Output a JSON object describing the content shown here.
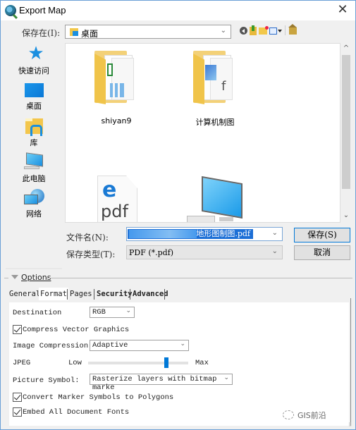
{
  "window": {
    "title": "Export Map",
    "close_glyph": "✕"
  },
  "lookin": {
    "label": "保存在(I):",
    "value": "桌面",
    "chevron": "⌄",
    "toolbar": [
      "back-icon",
      "up-folder-icon",
      "new-folder-icon",
      "view-menu-icon",
      "home-icon"
    ]
  },
  "places": [
    {
      "label": "快速访问",
      "icon": "quick-access-star-icon"
    },
    {
      "label": "桌面",
      "icon": "desktop-icon"
    },
    {
      "label": "库",
      "icon": "libraries-icon"
    },
    {
      "label": "此电脑",
      "icon": "this-pc-icon"
    },
    {
      "label": "网络",
      "icon": "network-icon"
    }
  ],
  "files": [
    {
      "name": "shiyan9",
      "type": "folder"
    },
    {
      "name": "计算机制图",
      "type": "folder"
    },
    {
      "name": "",
      "type": "pdf-file",
      "glyph": "e",
      "ext": "pdf"
    },
    {
      "name": "",
      "type": "computer-shortcut"
    }
  ],
  "scroll": {
    "up": "^",
    "down": "⌄"
  },
  "filename": {
    "label": "文件名(N):",
    "value": "地形图制图.pdf",
    "chevron": "⌄"
  },
  "filetype": {
    "label": "保存类型(T):",
    "value": "PDF (*.pdf)",
    "chevron": "⌄"
  },
  "buttons": {
    "save": "保存(S)",
    "cancel": "取消"
  },
  "options": {
    "header": "Options",
    "tabs": [
      {
        "label": "General",
        "active": false
      },
      {
        "label": "Format",
        "active": true
      },
      {
        "label": "Pages",
        "active": false
      },
      {
        "label": "Security",
        "active": false
      },
      {
        "label": "Advanced",
        "active": false
      }
    ],
    "format": {
      "destination_label": "Destination",
      "destination_value": "RGB",
      "compress_vector_label": "Compress Vector Graphics",
      "compress_vector_checked": true,
      "image_compression_label": "Image Compression:",
      "image_compression_value": "Adaptive",
      "jpeg_label": "JPEG",
      "jpeg_low": "Low",
      "jpeg_max": "Max",
      "jpeg_quality_fraction": 0.78,
      "picture_symbol_label": "Picture Symbol:",
      "picture_symbol_value": "Rasterize layers with bitmap marke",
      "convert_marker_label": "Convert Marker Symbols to Polygons",
      "convert_marker_checked": true,
      "embed_fonts_label": "Embed All Document Fonts",
      "embed_fonts_checked": true
    }
  },
  "watermark": "GIS前沿",
  "chevron": "⌄"
}
